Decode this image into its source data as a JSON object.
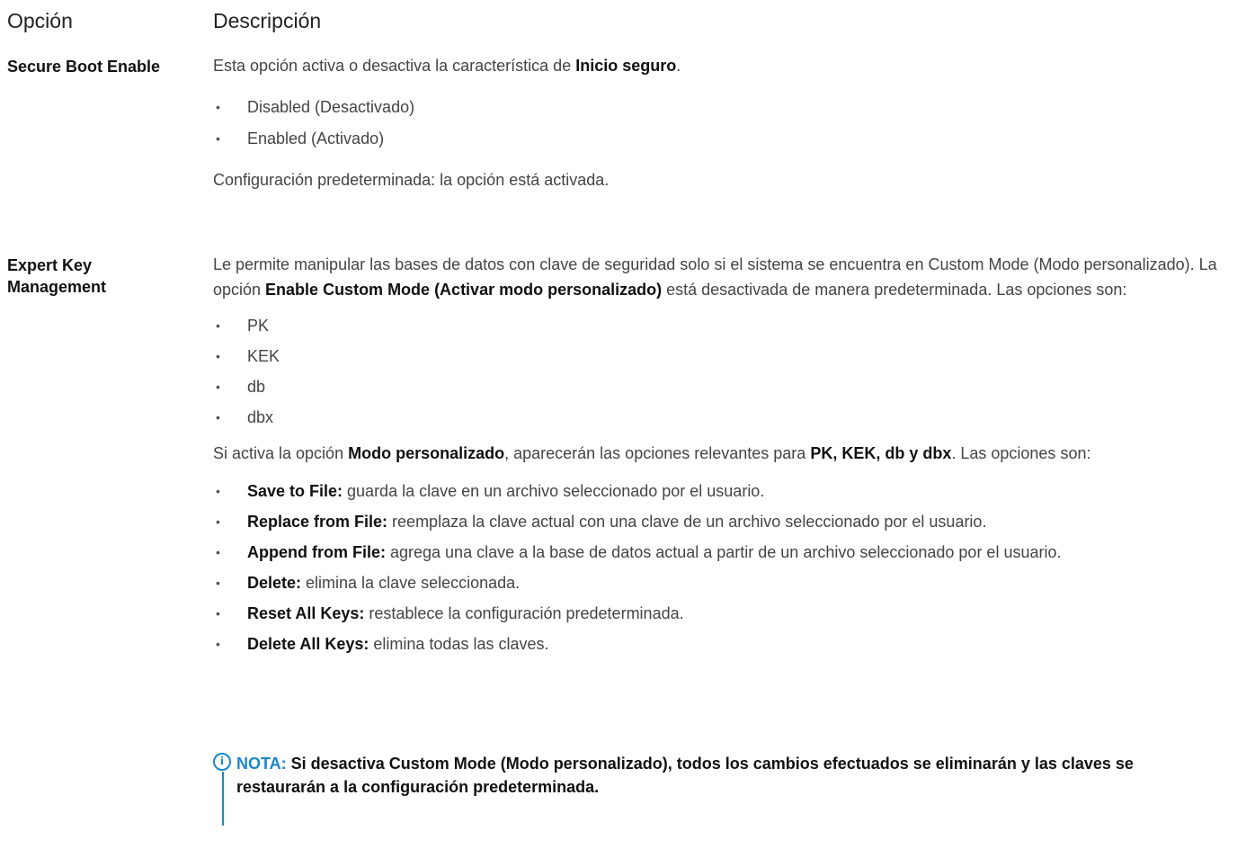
{
  "header": {
    "option_label": "Opción",
    "description_label": "Descripción"
  },
  "secure_boot": {
    "name": "Secure Boot Enable",
    "desc_prefix": "Esta opción activa o desactiva la característica de ",
    "desc_bold": "Inicio seguro",
    "desc_suffix": ".",
    "options": [
      "Disabled (Desactivado)",
      "Enabled (Activado)"
    ],
    "default_text": "Configuración predeterminada: la opción está activada."
  },
  "expert_key": {
    "name_line1": "Expert Key",
    "name_line2": "Management",
    "desc_part1": "Le permite manipular las bases de datos con clave de seguridad solo si el sistema se encuentra en Custom Mode (Modo personalizado). La opción ",
    "desc_bold": "Enable Custom Mode (Activar modo personalizado)",
    "desc_part2": " está desactivada de manera predeterminada. Las opciones son:",
    "options": [
      "PK",
      "KEK",
      "db",
      "dbx"
    ],
    "custom_intro_part1": "Si activa la opción ",
    "custom_intro_bold1": "Modo personalizado",
    "custom_intro_part2": ", aparecerán las opciones relevantes para ",
    "custom_intro_bold2": "PK, KEK, db y dbx",
    "custom_intro_part3": ". Las opciones son:",
    "actions": [
      {
        "term": "Save to File:",
        "text": " guarda la clave en un archivo seleccionado por el usuario."
      },
      {
        "term": "Replace from File:",
        "text": " reemplaza la clave actual con una clave de un archivo seleccionado por el usuario."
      },
      {
        "term": "Append from File:",
        "text": " agrega una clave a la base de datos actual a partir de un archivo seleccionado por el usuario."
      },
      {
        "term": "Delete:",
        "text": " elimina la clave seleccionada."
      },
      {
        "term": "Reset All Keys:",
        "text": " restablece la configuración predeterminada."
      },
      {
        "term": "Delete All Keys:",
        "text": " elimina todas las claves."
      }
    ]
  },
  "note": {
    "icon": "info-icon",
    "label": "NOTA:",
    "text": " Si desactiva Custom Mode (Modo personalizado), todos los cambios efectuados se eliminarán y las claves se restaurarán a la configuración predeterminada."
  },
  "colors": {
    "accent": "#1c87c9",
    "text": "#444444",
    "bold": "#111111"
  }
}
